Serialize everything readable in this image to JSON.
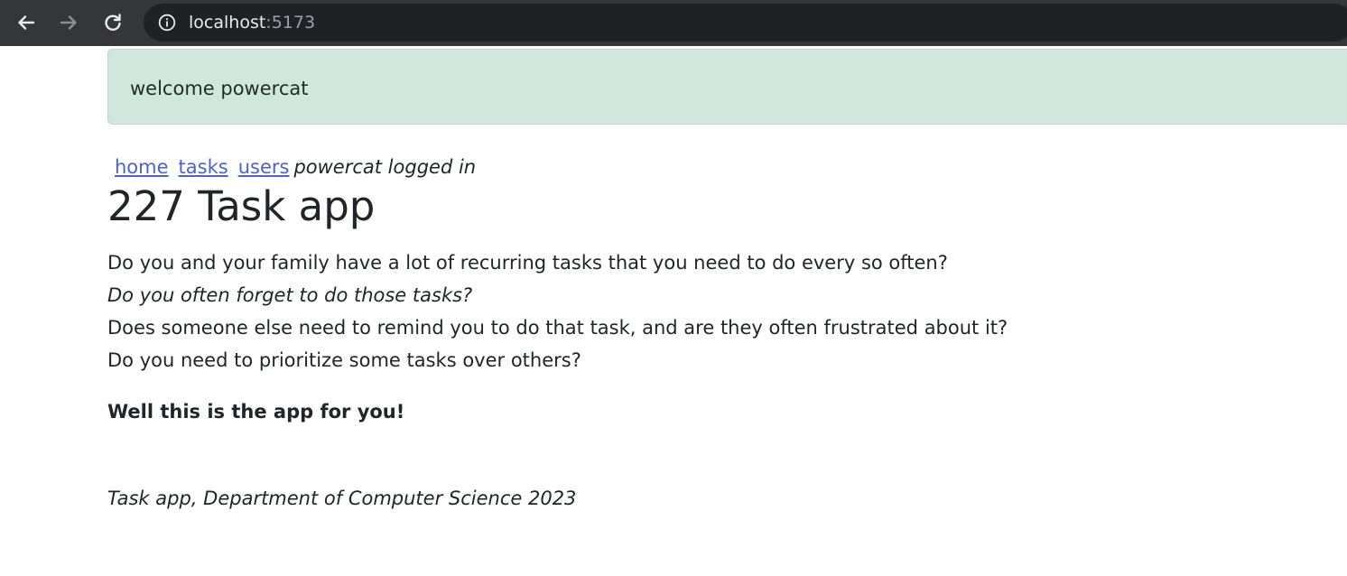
{
  "browser": {
    "url_host": "localhost",
    "url_port": ":5173",
    "icons": [
      "back-arrow-icon",
      "forward-arrow-icon",
      "reload-icon",
      "info-icon"
    ]
  },
  "alert": {
    "message": "welcome powercat",
    "background_color": "#d1e7dd"
  },
  "nav": {
    "links": [
      "home",
      "tasks",
      "users"
    ],
    "status": "powercat logged in",
    "link_color": "#4a62d6"
  },
  "main": {
    "title": "227 Task app",
    "lines": [
      "Do you and your family have a lot of recurring tasks that you need to do every so often?",
      "Do you often forget to do those tasks?",
      "Does someone else need to remind you to do that task, and are they often frustrated about it?",
      "Do you need to prioritize some tasks over others?"
    ],
    "tagline": "Well this is the app for you!"
  },
  "footer": {
    "text": "Task app, Department of Computer Science 2023"
  }
}
